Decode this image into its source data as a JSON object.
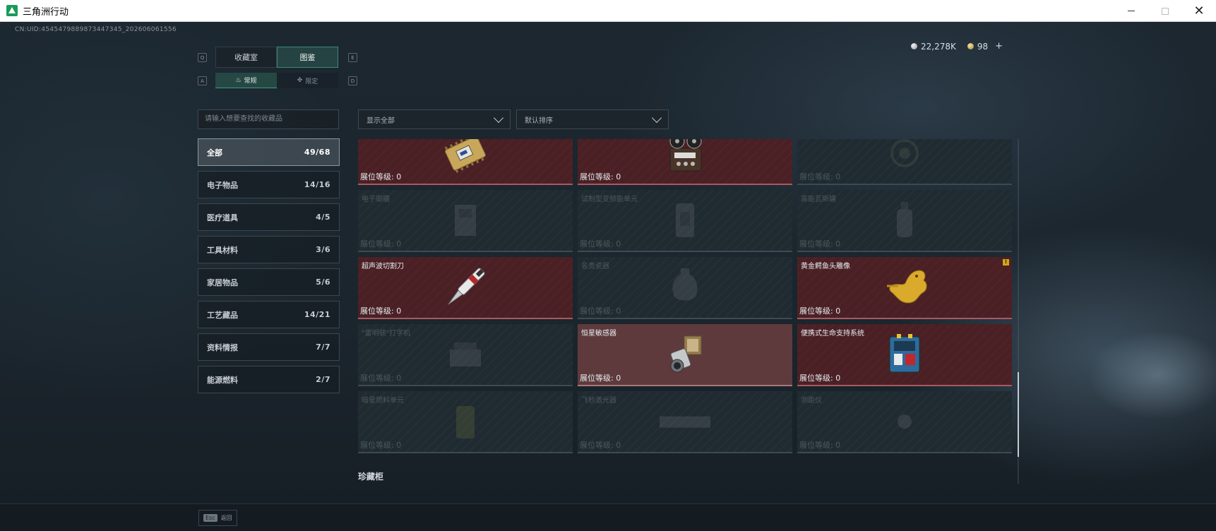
{
  "window": {
    "title": "三角洲行动",
    "controls": {
      "minimize": "—",
      "maximize": "☐",
      "close": "✕"
    }
  },
  "uid": "CN:UID:4545479889873447345_202606061556",
  "currency": {
    "silver": "22,278K",
    "gold": "98",
    "plus": "+"
  },
  "keys": {
    "prev_tab": "Q",
    "next_tab": "E",
    "prev_sub": "A",
    "next_sub": "D"
  },
  "tabs": [
    {
      "label": "收藏室",
      "active": false
    },
    {
      "label": "图鉴",
      "active": true
    }
  ],
  "subtabs": [
    {
      "label": "常规",
      "icon": "flame-icon",
      "active": true
    },
    {
      "label": "限定",
      "icon": "laurel-icon",
      "active": false
    }
  ],
  "search": {
    "placeholder": "请输入想要查找的收藏品"
  },
  "filters": {
    "show": "显示全部",
    "sort": "默认排序"
  },
  "categories": [
    {
      "label": "全部",
      "count": "49/68",
      "active": true
    },
    {
      "label": "电子物品",
      "count": "14/16"
    },
    {
      "label": "医疗道具",
      "count": "4/5"
    },
    {
      "label": "工具材料",
      "count": "3/6"
    },
    {
      "label": "家居物品",
      "count": "5/6"
    },
    {
      "label": "工艺藏品",
      "count": "14/21"
    },
    {
      "label": "资料情报",
      "count": "7/7"
    },
    {
      "label": "能源燃料",
      "count": "2/7"
    }
  ],
  "level_label": "展位等级: 0",
  "items": [
    {
      "name": "",
      "owned": true,
      "icon": "circuit-board-icon"
    },
    {
      "name": "",
      "owned": true,
      "icon": "tape-recorder-icon"
    },
    {
      "name": "",
      "owned": false,
      "icon": "ornament-icon"
    },
    {
      "name": "电子御膳",
      "owned": false,
      "icon": "device-icon"
    },
    {
      "name": "试制型变频能单元",
      "owned": false,
      "icon": "cell-icon"
    },
    {
      "name": "高能瓦斯罐",
      "owned": false,
      "icon": "canister-icon"
    },
    {
      "name": "超声波切割刀",
      "owned": true,
      "icon": "cutter-icon"
    },
    {
      "name": "名贵瓷器",
      "owned": false,
      "icon": "vase-icon"
    },
    {
      "name": "黄金鳄鱼头雕像",
      "owned": true,
      "icon": "gold-statue-icon",
      "warning": "!"
    },
    {
      "name": "\"雷明顿\"打字机",
      "owned": false,
      "icon": "typewriter-icon"
    },
    {
      "name": "恒星敏感器",
      "owned": true,
      "light": true,
      "icon": "star-sensor-icon"
    },
    {
      "name": "便携式生命支持系统",
      "owned": true,
      "icon": "life-support-icon"
    },
    {
      "name": "暗星燃料单元",
      "owned": false,
      "icon": "fuel-cell-icon"
    },
    {
      "name": "飞秒激光器",
      "owned": false,
      "icon": "laser-icon"
    },
    {
      "name": "测距仪",
      "owned": false,
      "icon": "rangefinder-icon"
    }
  ],
  "section_title": "珍藏柜",
  "footer": {
    "esc_key": "Esc",
    "esc_label": "返回"
  },
  "colors": {
    "accent_green": "#3a8b74",
    "owned_card": "#4a2025",
    "warning": "#d6a516"
  }
}
